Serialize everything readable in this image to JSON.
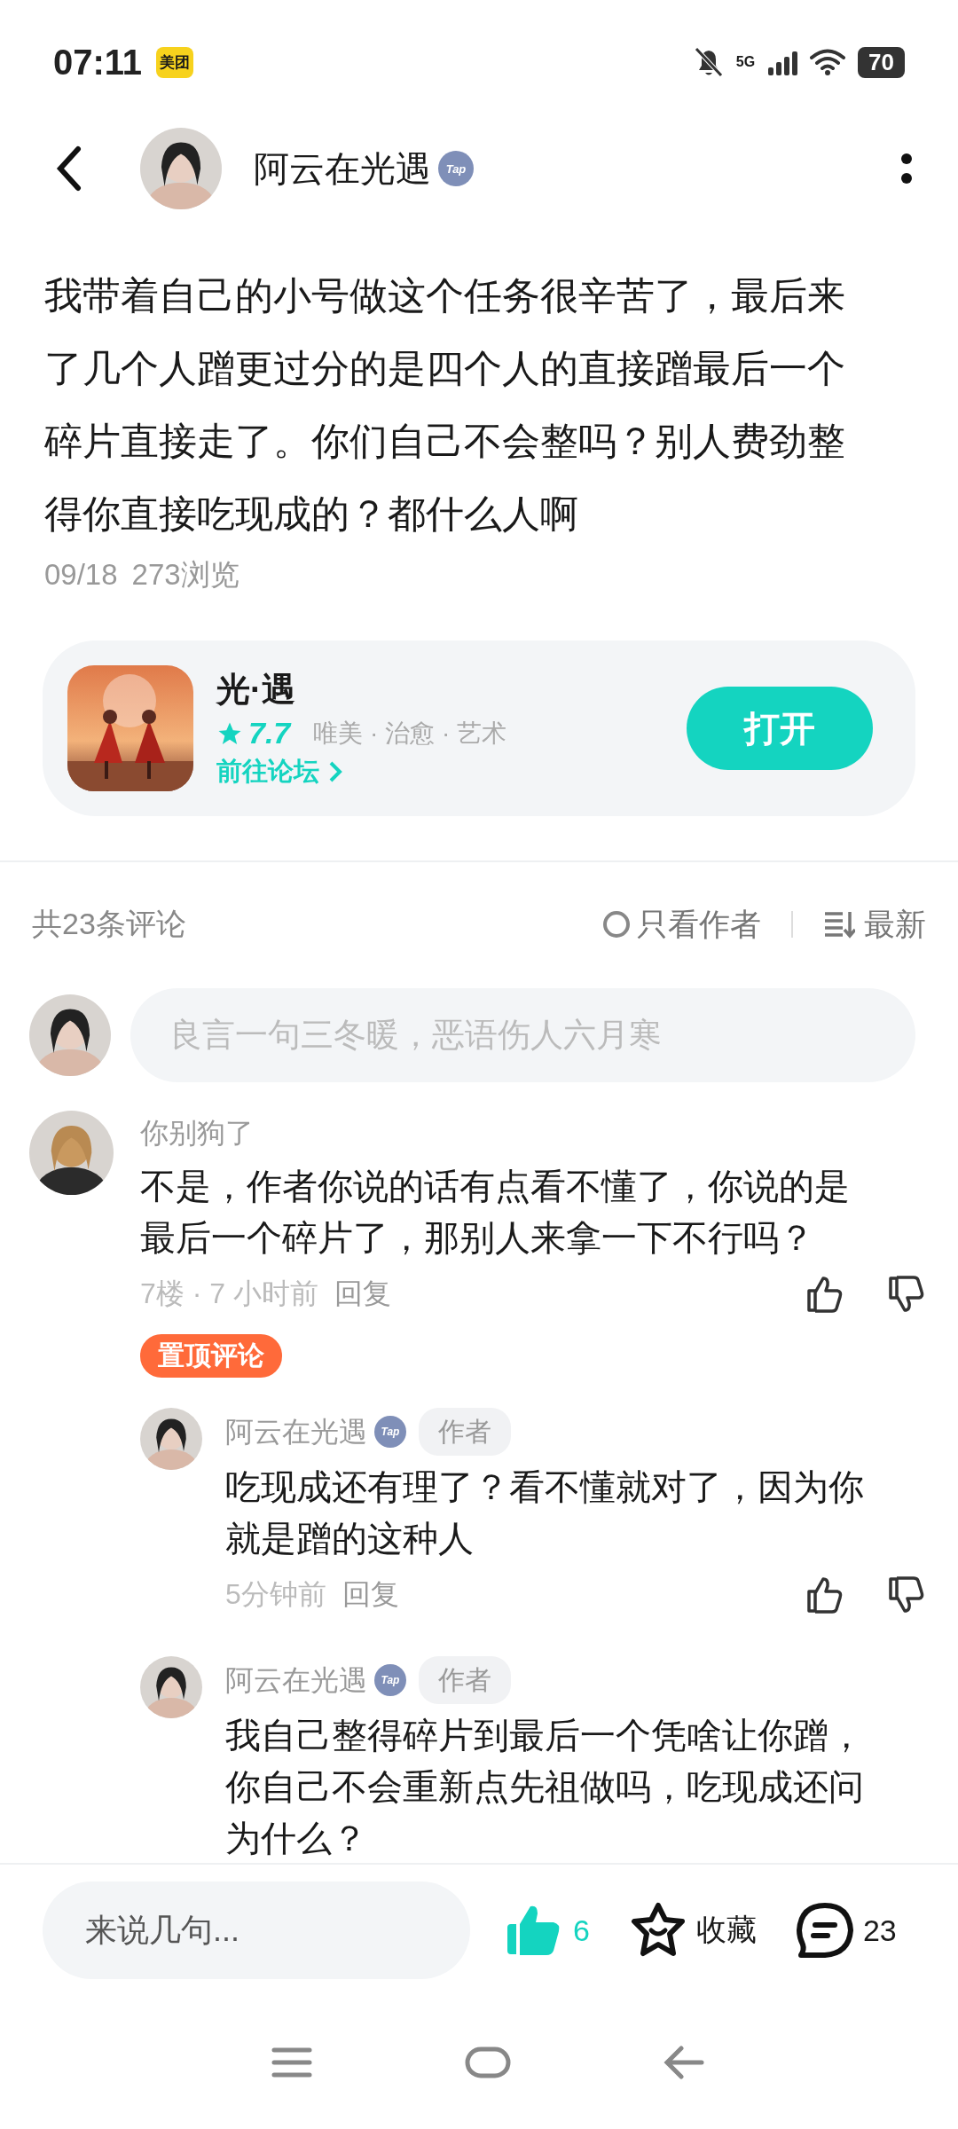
{
  "status_bar": {
    "time": "07:11",
    "app_badge": "美团",
    "network": "5G",
    "battery": "70"
  },
  "header": {
    "name": "阿云在光遇",
    "badge": "Tap"
  },
  "post": {
    "text": "我带着自己的小号做这个任务很辛苦了，最后来了几个人蹭更过分的是四个人的直接蹭最后一个碎片直接走了。你们自己不会整吗？别人费劲整得你直接吃现成的？都什么人啊",
    "date": "09/18",
    "views": "273浏览"
  },
  "game_card": {
    "title": "光·遇",
    "rating": "7.7",
    "tags": "唯美 · 治愈 · 艺术",
    "forum_link": "前往论坛",
    "button": "打开"
  },
  "comments_header": {
    "count": "共23条评论",
    "author_only": {
      "label": "只看作者",
      "checked": false
    },
    "sort": "最新"
  },
  "comment_input": {
    "placeholder": "良言一句三冬暖，恶语伤人六月寒"
  },
  "comments": [
    {
      "name": "你别狗了",
      "text": "不是，作者你说的话有点看不懂了，你说的是最后一个碎片了，那别人来拿一下不行吗？",
      "meta": "7楼 · 7 小时前",
      "reply": "回复",
      "liked": false,
      "pinned_badge": "置顶评论",
      "replies": [
        {
          "name": "阿云在光遇",
          "badge": "Tap",
          "tag": "作者",
          "text": "吃现成还有理了？看不懂就对了，因为你就是蹭的这种人",
          "meta": "5分钟前",
          "reply": "回复",
          "liked": false
        },
        {
          "name": "阿云在光遇",
          "badge": "Tap",
          "tag": "作者",
          "text": "我自己整得碎片到最后一个凭啥让你蹭，你自己不会重新点先祖做吗，吃现成还问为什么？"
        }
      ]
    }
  ],
  "bottom_bar": {
    "placeholder": "来说几句...",
    "likes": "6",
    "liked": true,
    "favorite": "收藏",
    "comments": "23"
  }
}
